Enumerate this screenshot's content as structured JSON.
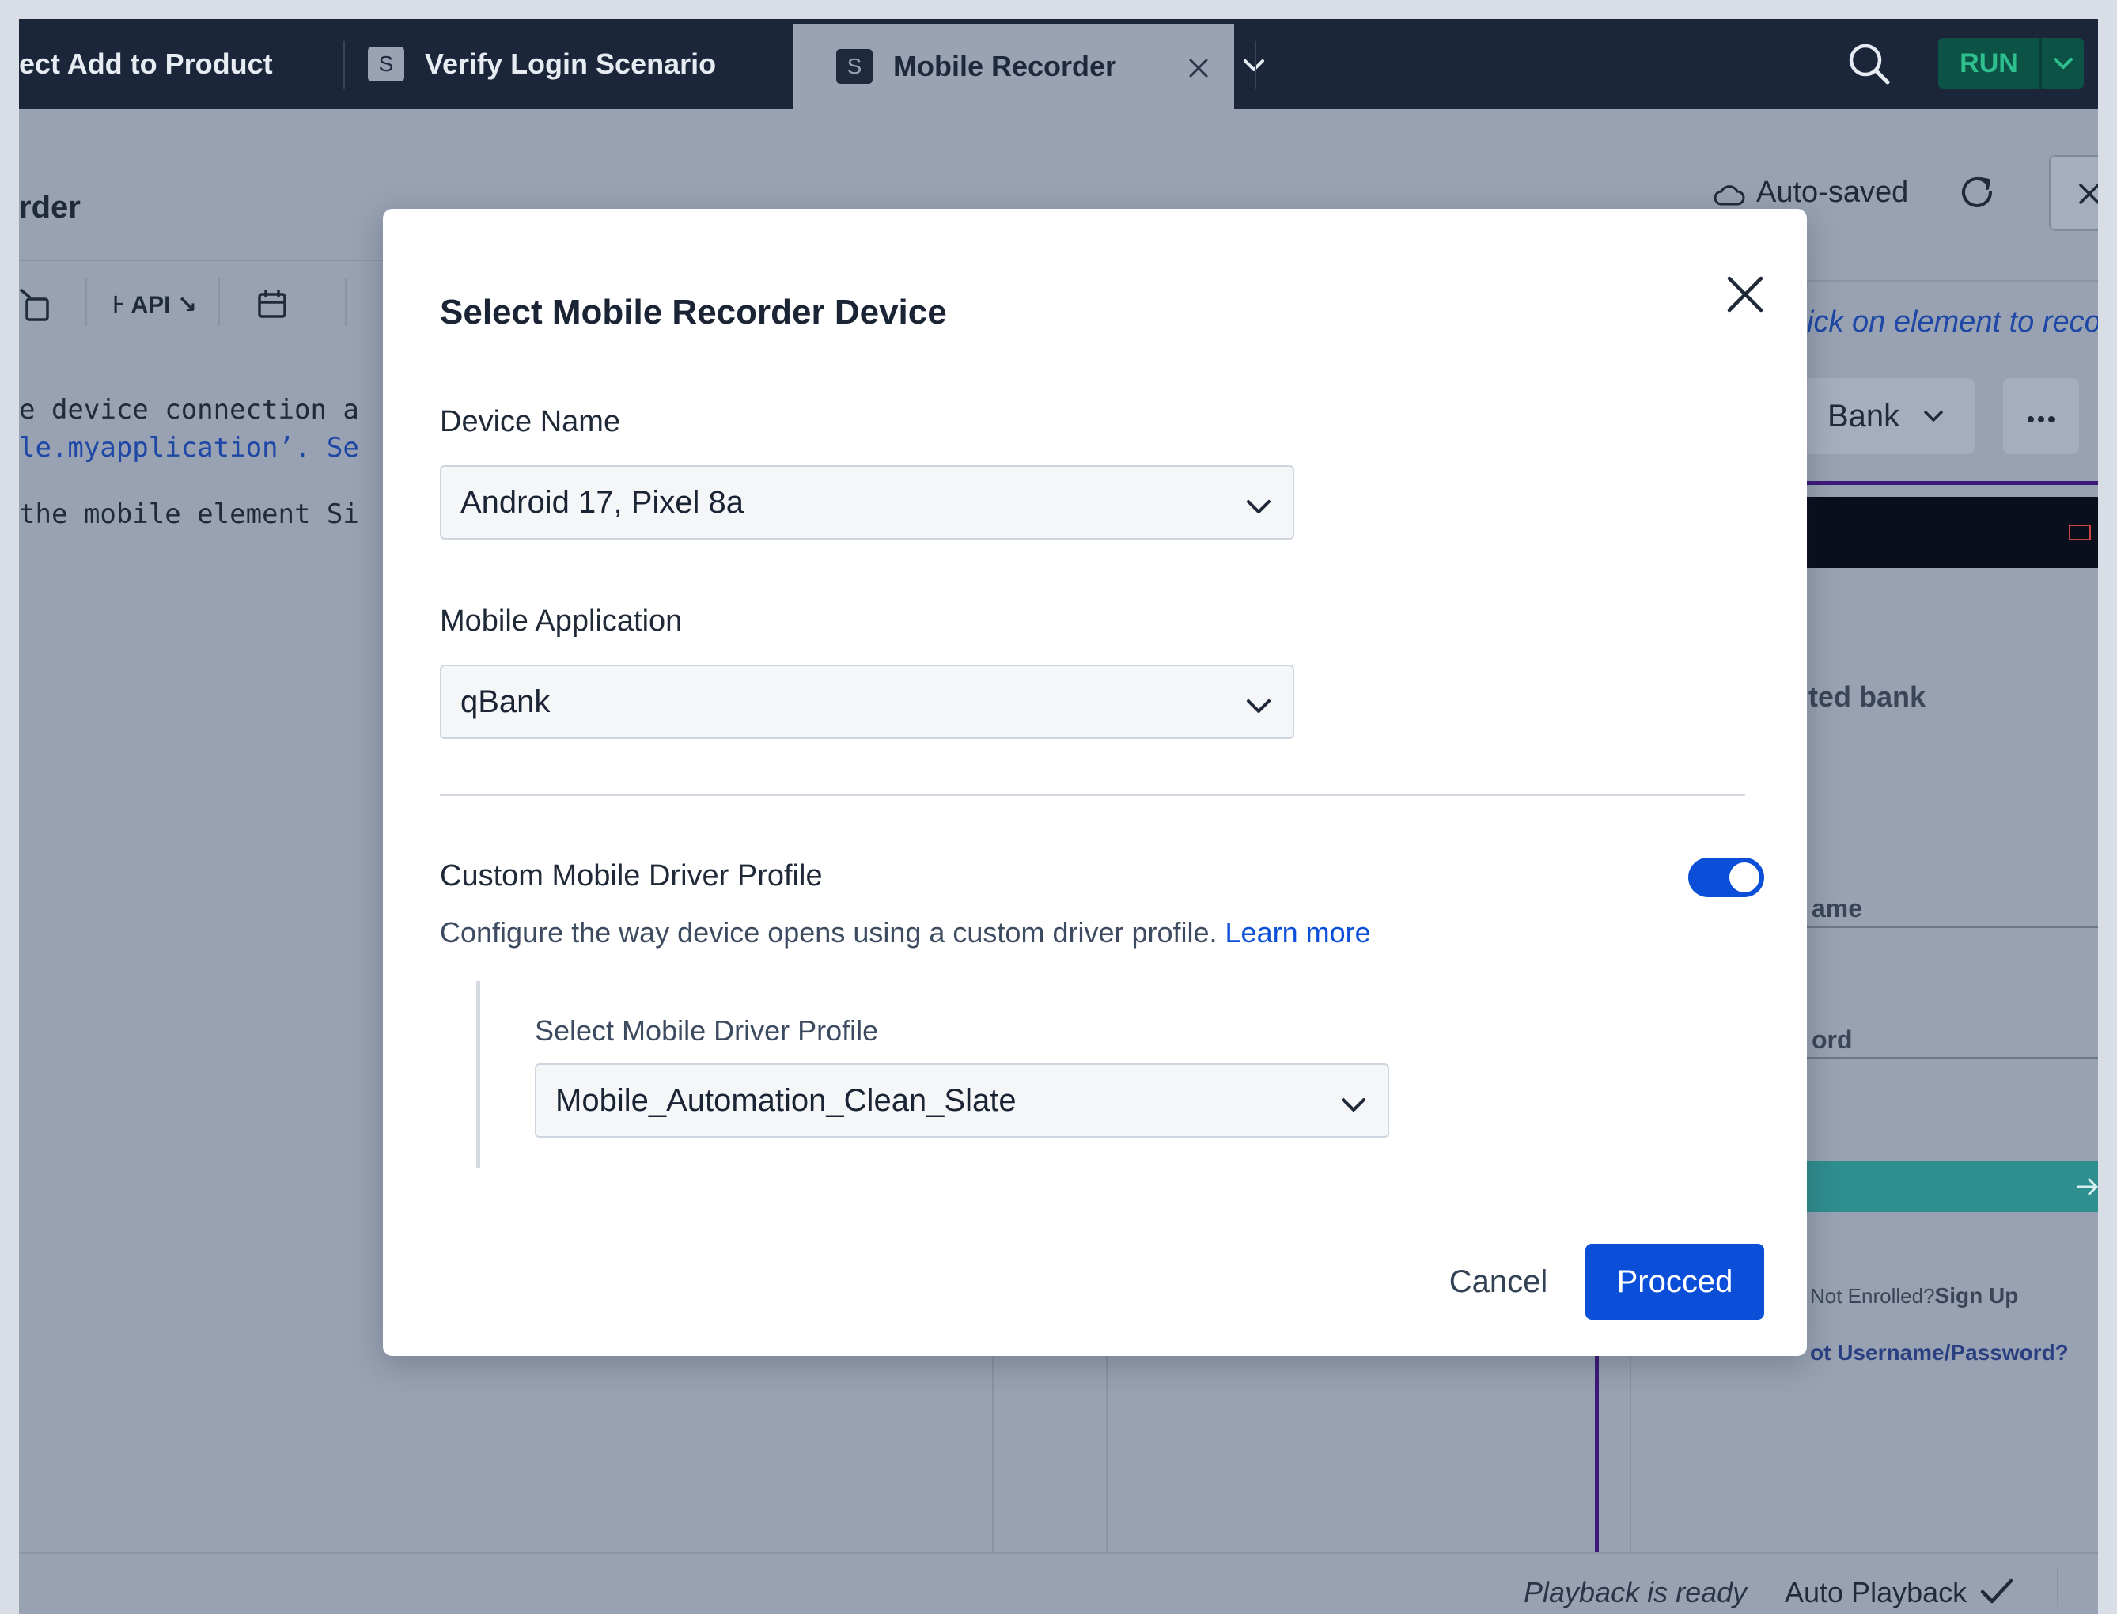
{
  "tabs": [
    {
      "label": "ect Add to Product",
      "badge": ""
    },
    {
      "label": "Verify Login Scenario",
      "badge": "S"
    },
    {
      "label": "Mobile Recorder",
      "badge": "S",
      "active": true
    }
  ],
  "header": {
    "run_label": "RUN"
  },
  "workspace": {
    "title_fragment": "rder",
    "auto_saved": "Auto-saved",
    "toolbar_api": "⊦ API ↘",
    "code_lines": [
      "e device connection a",
      "le.myapplication’. Se",
      "the mobile element Si"
    ],
    "preview_hint": "ick on element to record",
    "app_dropdown": "Bank",
    "phone_texts": {
      "bank": "ted bank",
      "username": "ame",
      "password": "ord",
      "not_enrolled": "Not Enrolled?",
      "sign_up": "Sign Up",
      "forgot": "ot Username/Password?"
    },
    "footer_status": "Playback is ready",
    "footer_auto": "Auto Playback"
  },
  "modal": {
    "title": "Select Mobile Recorder Device",
    "device_label": "Device Name",
    "device_value": "Android 17, Pixel 8a",
    "app_label": "Mobile Application",
    "app_value": "qBank",
    "custom_title": "Custom Mobile Driver Profile",
    "custom_desc": "Configure the way device opens using a custom driver profile.",
    "learn_more": "Learn more",
    "profile_label": "Select Mobile Driver Profile",
    "profile_value": "Mobile_Automation_Clean_Slate",
    "cancel": "Cancel",
    "proceed": "Procced"
  },
  "colors": {
    "primary": "#0b4fd9",
    "tabbar": "#1b263b",
    "run_bg": "#0c5345",
    "run_text": "#2fbf8f"
  },
  "icons": [
    "search-icon",
    "chevron-down-icon",
    "close-icon",
    "refresh-icon",
    "cloud-icon",
    "checkmark-icon",
    "more-icon",
    "calendar-icon"
  ]
}
